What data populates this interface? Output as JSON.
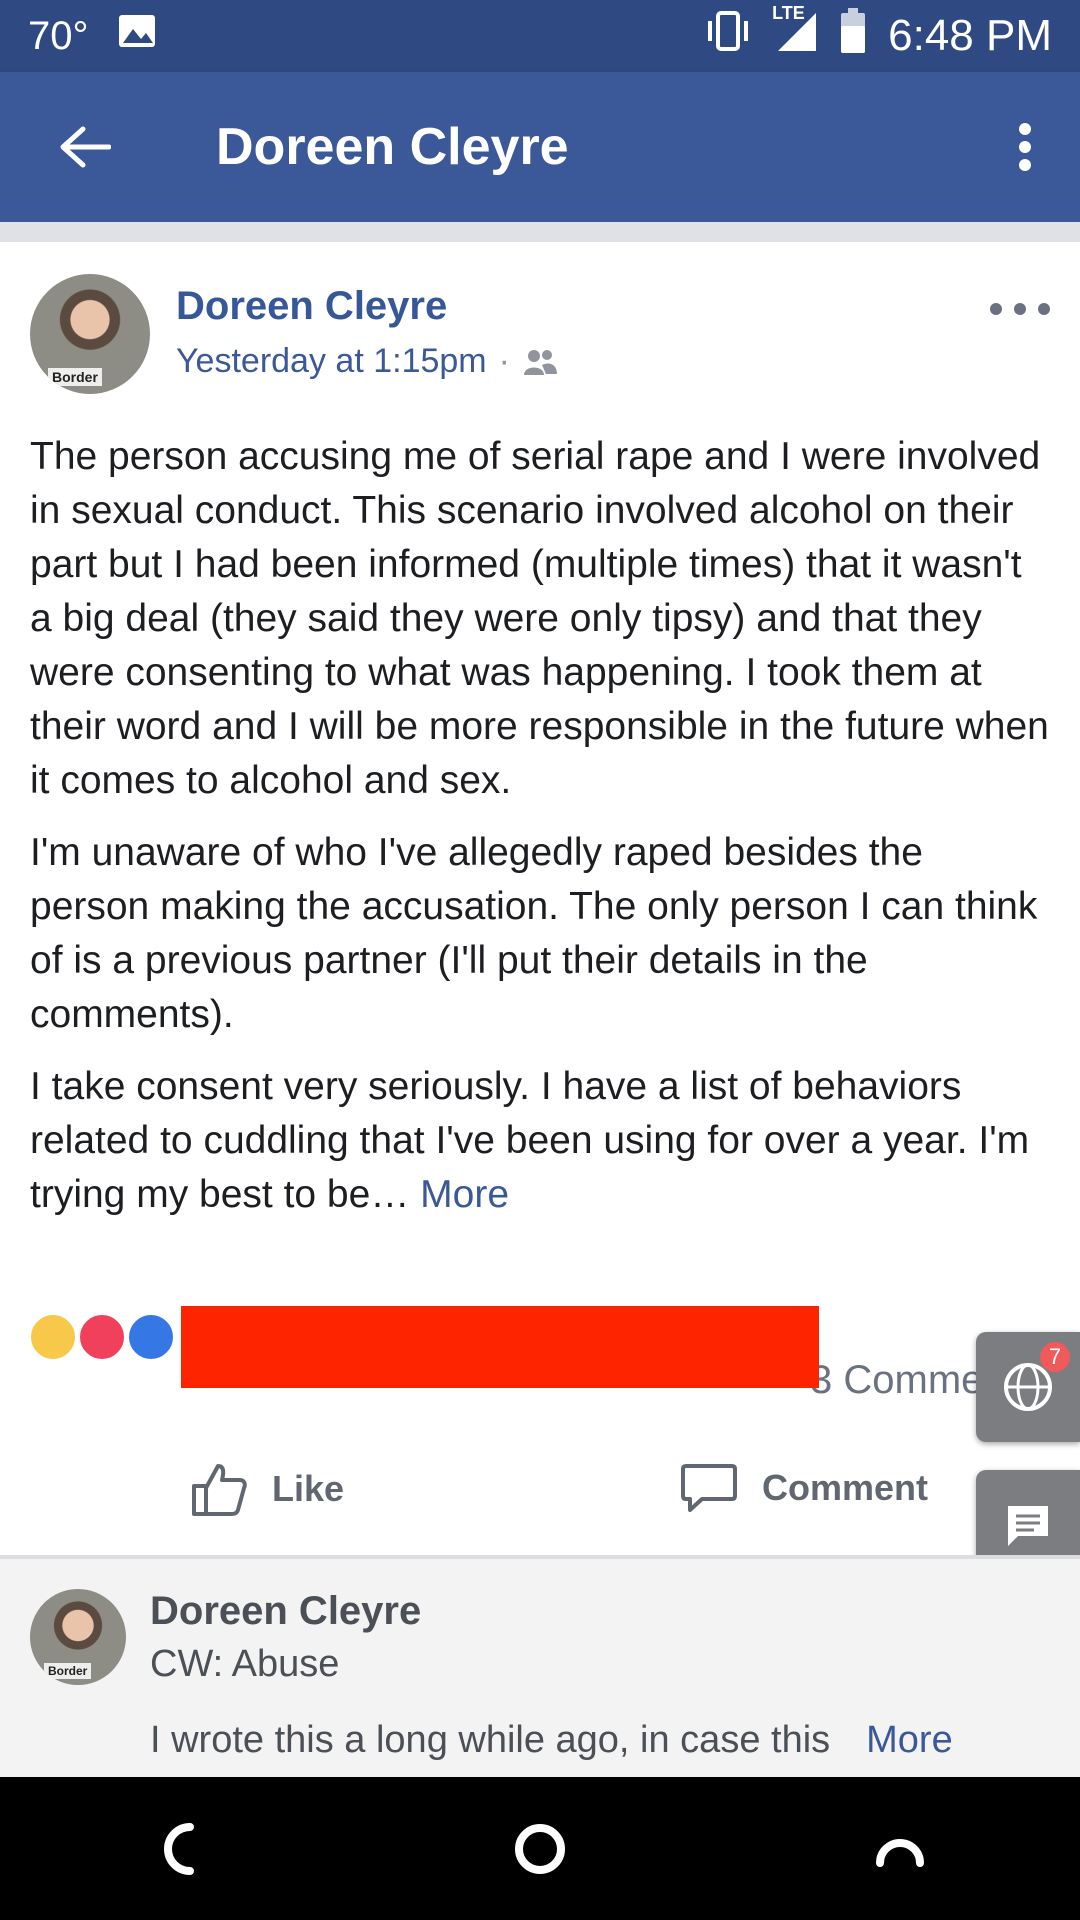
{
  "status_bar": {
    "temperature": "70°",
    "network": "LTE",
    "time": "6:48 PM"
  },
  "app_bar": {
    "title": "Doreen Cleyre"
  },
  "post": {
    "author": "Doreen Cleyre",
    "timestamp": "Yesterday at 1:15pm",
    "separator": "·",
    "avatar_badge": "Border",
    "paragraphs": [
      "The person accusing me of serial rape and I were involved in sexual conduct. This scenario involved alcohol on their part but I had been informed (multiple times) that it wasn't a big deal (they said they were only tipsy) and that they were consenting to what was happening. I took them at their word and I will be more responsible in the future when it comes to alcohol and sex.",
      "I'm unaware of who I've allegedly raped besides the person making the accusation. The only person I can think of is a previous partner (I'll put their details in the comments).",
      "I take consent very seriously. I have a list of behaviors related to cuddling that I've been using for over a year. I'm trying my best to be… "
    ],
    "more_link": "More",
    "comments_count": "3 Comments",
    "actions": {
      "like": "Like",
      "comment": "Comment"
    }
  },
  "floating": {
    "badge_count": "7"
  },
  "next_post": {
    "author": "Doreen Cleyre",
    "subtitle": "CW: Abuse",
    "preview": "I wrote this a long while ago, in case this",
    "more_link": "More"
  },
  "colors": {
    "status_bar": "#2f4a83",
    "app_bar": "#3b5998",
    "redaction": "#ff2400"
  }
}
